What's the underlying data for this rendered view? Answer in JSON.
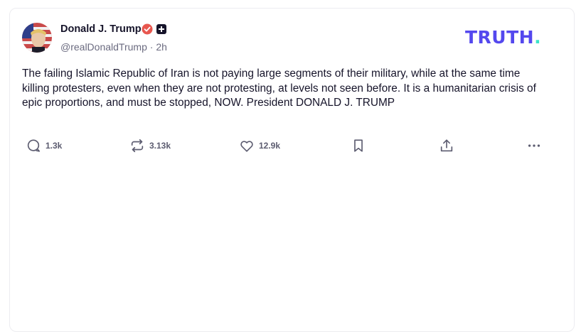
{
  "post": {
    "author_name": "Donald J. Trump",
    "handle": "@realDonaldTrump",
    "separator": "·",
    "time": "2h",
    "verified_icon": "verified-badge-icon",
    "plus_icon": "plus-square-icon",
    "body": "The failing Islamic Republic of Iran is not paying large segments of their military, while at the same time killing protesters, even when they are not protesting, at levels not seen before. It is a humanitarian  crisis of epic proportions, and must be stopped, NOW. President DONALD J. TRUMP"
  },
  "brand": {
    "logo_text": "TRUTH",
    "logo_dot": ".",
    "primary": "#5448ee",
    "accent": "#3ee3c9"
  },
  "actions": {
    "replies": {
      "icon": "reply-bubble-icon",
      "count": "1.3k"
    },
    "retruths": {
      "icon": "retruth-icon",
      "count": "3.13k"
    },
    "likes": {
      "icon": "heart-icon",
      "count": "12.9k"
    },
    "bookmark": {
      "icon": "bookmark-icon"
    },
    "share": {
      "icon": "share-icon"
    },
    "more": {
      "icon": "more-dots-icon"
    }
  },
  "colors": {
    "text": "#16142a",
    "muted": "#6b6b80",
    "border": "#ececf0",
    "verified": "#e8574f"
  }
}
